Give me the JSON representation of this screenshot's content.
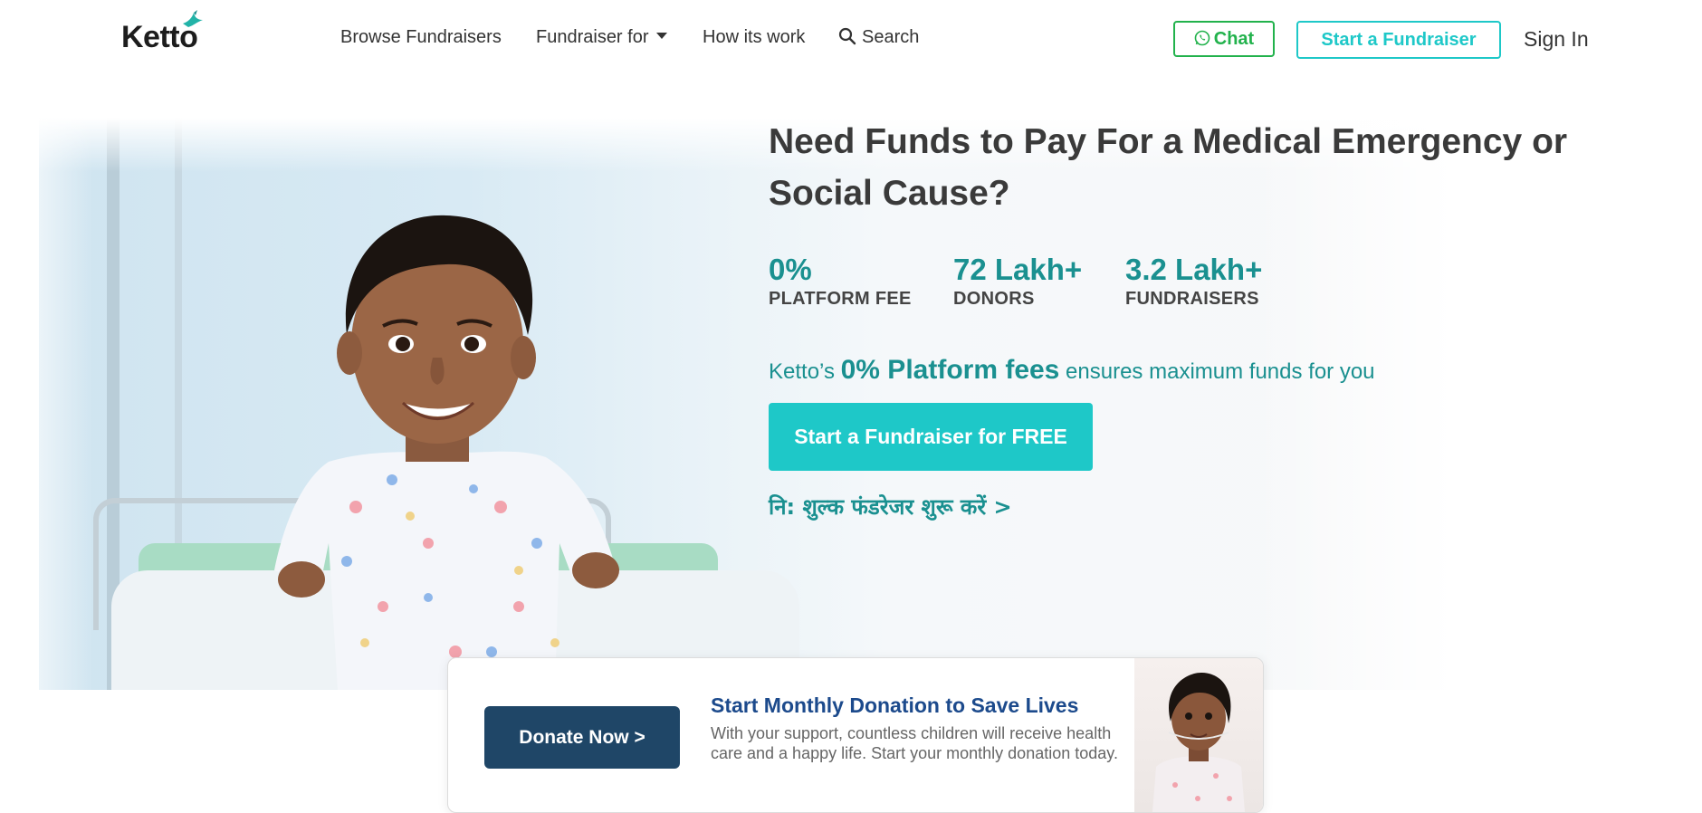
{
  "brand": {
    "name": "Ketto",
    "accent": "#1ec8c8",
    "teal": "#1a9090",
    "navy": "#1f4667",
    "chat_green": "#22b24c"
  },
  "nav": {
    "browse": "Browse Fundraisers",
    "fundraiser_for": "Fundraiser for",
    "how": "How its work",
    "search": "Search"
  },
  "header_actions": {
    "chat": "Chat",
    "start": "Start a Fundraiser",
    "signin": "Sign In"
  },
  "hero": {
    "headline": "Need Funds to Pay For a Medical Emergency or Social Cause?",
    "stats": [
      {
        "value": "0%",
        "label": "PLATFORM FEE"
      },
      {
        "value": "72 Lakh+",
        "label": "DONORS"
      },
      {
        "value": "3.2 Lakh+",
        "label": "FUNDRAISERS"
      }
    ],
    "tagline_prefix": "Ketto’s",
    "tagline_bold": "0% Platform fees",
    "tagline_suffix": "ensures maximum funds for you",
    "cta": "Start a Fundraiser for FREE",
    "hindi_link": "नि: शुल्क फंडरेजर शुरू करें >"
  },
  "donation_card": {
    "button": "Donate Now >",
    "title": "Start Monthly Donation to Save Lives",
    "text": "With your support, countless children will receive health care and a happy life. Start your monthly donation today."
  }
}
